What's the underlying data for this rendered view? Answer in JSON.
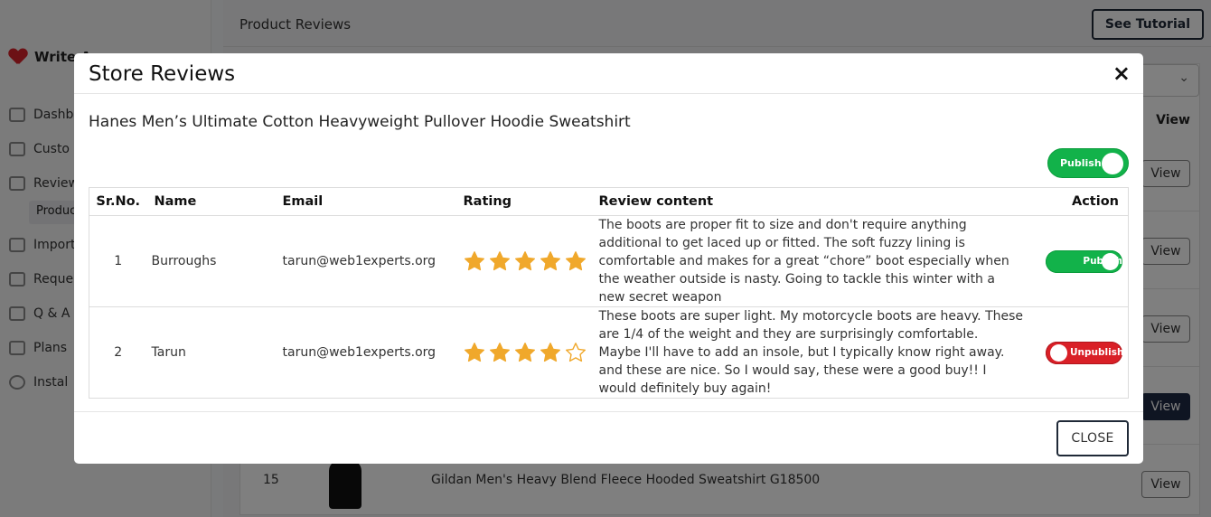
{
  "sidebar": {
    "brand": "Write A",
    "items": [
      {
        "label": "Dashb"
      },
      {
        "label": "Custo"
      },
      {
        "label": "Review"
      },
      {
        "label": "Import"
      },
      {
        "label": "Reque"
      },
      {
        "label": "Q & A"
      },
      {
        "label": "Plans"
      },
      {
        "label": "Instal"
      }
    ],
    "sub_item": "Produc"
  },
  "main": {
    "title": "Product Reviews",
    "tutorial_label": "See Tutorial",
    "view_header": "View",
    "view_label": "View",
    "row15": {
      "number": "15",
      "product": "Gildan Men's Heavy Blend Fleece Hooded Sweatshirt G18500"
    }
  },
  "modal": {
    "title": "Store Reviews",
    "close_icon": "×",
    "product_title": "Hanes Men’s Ultimate Cotton Heavyweight Pullover Hoodie Sweatshirt",
    "master_toggle": {
      "label": "Publish",
      "state": "on"
    },
    "columns": [
      "Sr.No.",
      "Name",
      "Email",
      "Rating",
      "Review content",
      "Action"
    ],
    "reviews": [
      {
        "sr": "1",
        "name": "Burroughs",
        "email": "tarun@web1experts.org",
        "rating": 5,
        "content": "The boots are proper fit to size and don't require anything additional to get laced up or fitted. The soft fuzzy lining is comfortable and makes for a great “chore” boot especially when the weather outside is nasty. Going to tackle this winter with a new secret weapon",
        "action_label": "Publish",
        "action_state": "on"
      },
      {
        "sr": "2",
        "name": "Tarun",
        "email": "tarun@web1experts.org",
        "rating": 4,
        "content": "These boots are super light. My motorcycle boots are heavy. These are 1/4 of the weight and they are surprisingly comfortable. Maybe I'll have to add an insole, but I typically know right away. and these are nice. So I would say, these were a good buy!! I would definitely buy again!",
        "action_label": "Unpublish",
        "action_state": "off"
      }
    ],
    "close_label": "CLOSE"
  },
  "colors": {
    "publish_green": "#12b24a",
    "unpublish_red": "#d92027",
    "star_gold": "#f0a82b",
    "overlay": "rgba(0,0,0,0.5)"
  }
}
